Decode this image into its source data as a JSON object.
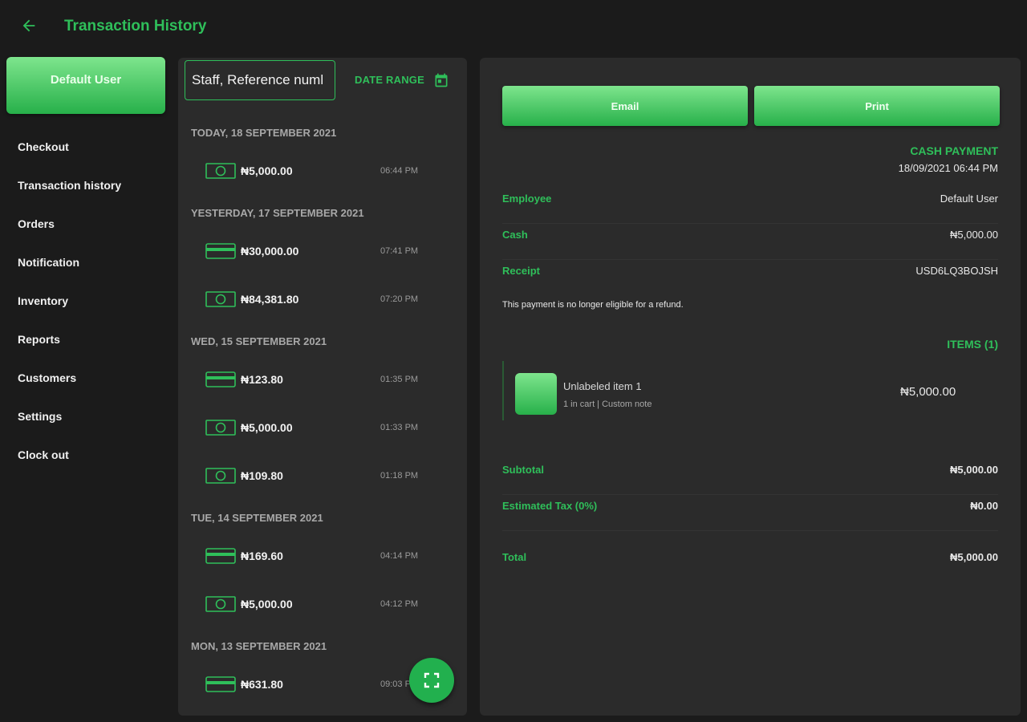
{
  "header": {
    "title": "Transaction History"
  },
  "sidebar": {
    "user_label": "Default User",
    "items": [
      {
        "label": "Checkout"
      },
      {
        "label": "Transaction history"
      },
      {
        "label": "Orders"
      },
      {
        "label": "Notification"
      },
      {
        "label": "Inventory"
      },
      {
        "label": "Reports"
      },
      {
        "label": "Customers"
      },
      {
        "label": "Settings"
      },
      {
        "label": "Clock out"
      }
    ]
  },
  "transactions": {
    "search_value": "Staff, Reference numl",
    "date_range_label": "DATE RANGE",
    "groups": [
      {
        "header": "TODAY, 18 SEPTEMBER 2021",
        "rows": [
          {
            "method": "cash",
            "amount": "₦5,000.00",
            "time": "06:44 PM"
          }
        ]
      },
      {
        "header": "YESTERDAY, 17 SEPTEMBER 2021",
        "rows": [
          {
            "method": "card",
            "amount": "₦30,000.00",
            "time": "07:41 PM"
          },
          {
            "method": "cash",
            "amount": "₦84,381.80",
            "time": "07:20 PM"
          }
        ]
      },
      {
        "header": "WED, 15 SEPTEMBER 2021",
        "rows": [
          {
            "method": "card",
            "amount": "₦123.80",
            "time": "01:35 PM"
          },
          {
            "method": "cash",
            "amount": "₦5,000.00",
            "time": "01:33 PM"
          },
          {
            "method": "cash",
            "amount": "₦109.80",
            "time": "01:18 PM"
          }
        ]
      },
      {
        "header": "TUE, 14 SEPTEMBER 2021",
        "rows": [
          {
            "method": "card",
            "amount": "₦169.60",
            "time": "04:14 PM"
          },
          {
            "method": "cash",
            "amount": "₦5,000.00",
            "time": "04:12 PM"
          }
        ]
      },
      {
        "header": "MON, 13 SEPTEMBER 2021",
        "rows": [
          {
            "method": "card",
            "amount": "₦631.80",
            "time": "09:03 PM"
          }
        ]
      }
    ]
  },
  "detail": {
    "email_label": "Email",
    "print_label": "Print",
    "payment_type": "CASH PAYMENT",
    "payment_datetime": "18/09/2021 06:44 PM",
    "employee_label": "Employee",
    "employee_value": "Default User",
    "cash_label": "Cash",
    "cash_value": "₦5,000.00",
    "receipt_label": "Receipt",
    "receipt_value": "USD6LQ3BOJSH",
    "refund_note": "This payment is no longer eligible for a refund.",
    "items_heading": "ITEMS (1)",
    "item": {
      "name": "Unlabeled item 1",
      "subtitle": "1 in cart  |  Custom note",
      "price": "₦5,000.00"
    },
    "subtotal_label": "Subtotal",
    "subtotal_value": "₦5,000.00",
    "tax_label": "Estimated Tax (0%)",
    "tax_value": "₦0.00",
    "total_label": "Total",
    "total_value": "₦5,000.00"
  },
  "colors": {
    "accent": "#2fbf5a",
    "background": "#1b1b1b",
    "panel": "#2b2b2b"
  },
  "icons": {
    "back": "arrow-left-icon",
    "calendar": "calendar-icon",
    "cash": "cash-icon",
    "card": "credit-card-icon",
    "fab": "fullscreen-icon"
  }
}
